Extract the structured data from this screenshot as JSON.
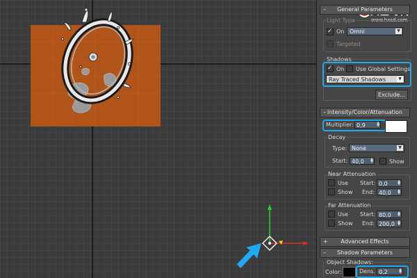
{
  "viewport": {
    "name": "perspective-viewport",
    "watermark_title": "火星时代",
    "watermark_url": "www.hxsd.com"
  },
  "general": {
    "title": "General Parameters",
    "light_type_label": "Light Type",
    "on_label": "On",
    "light_type": "Omni",
    "targeted_label": "Targeted",
    "shadows_label": "Shadows",
    "shadows_on_label": "On",
    "use_global_label": "Use Global Settings",
    "shadow_type": "Ray Traced Shadows",
    "exclude_label": "Exclude..."
  },
  "intensity": {
    "title": "Intensity/Color/Attenuation",
    "multiplier_label": "Multiplier:",
    "multiplier": "0,9",
    "decay_label": "Decay",
    "type_label": "Type:",
    "decay_type": "None",
    "start_label": "Start:",
    "start_value": "40,0",
    "show_label": "Show",
    "near_label": "Near Attenuation",
    "near_use_label": "Use",
    "near_show_label": "Show",
    "near_start_label": "Start:",
    "near_start": "0,0",
    "near_end_label": "End:",
    "near_end": "40,0",
    "far_label": "Far Attenuation",
    "far_use_label": "Use",
    "far_show_label": "Show",
    "far_start_label": "Start:",
    "far_start": "80,0",
    "far_end_label": "End:",
    "far_end": "200,0"
  },
  "advanced": {
    "title": "Advanced Effects"
  },
  "shadow_params": {
    "title": "Shadow Parameters",
    "object_shadows_label": "Object Shadows:",
    "color_label": "Color:",
    "dens_label": "Dens.",
    "dens_value": "0,2"
  },
  "colors": {
    "highlight": "#1ea9f0",
    "plane": "#b05419",
    "light_color": "#ffffff",
    "shadow_color": "#000000"
  }
}
